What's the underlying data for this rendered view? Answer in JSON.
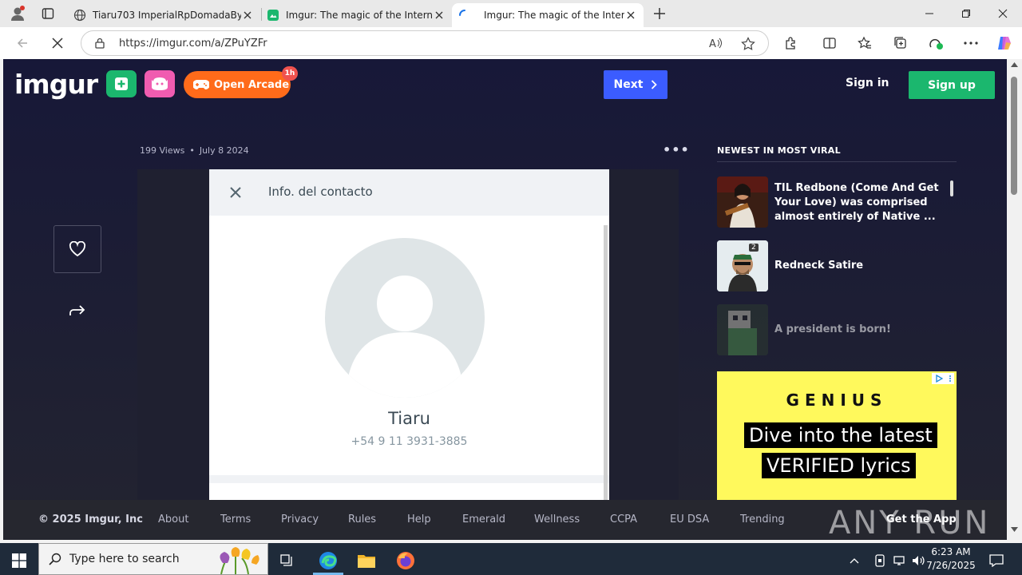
{
  "browser": {
    "tabs": [
      {
        "label": "Tiaru703 ImperialRpDomadaBy25",
        "icon": "globe-icon",
        "active": false
      },
      {
        "label": "Imgur: The magic of the Internet",
        "icon": "imgur-favicon-icon",
        "active": false
      },
      {
        "label": "Imgur: The magic of the Internet",
        "icon": "loading-spinner-icon",
        "active": true
      }
    ],
    "url": "https://imgur.com/a/ZPuYZFr"
  },
  "header": {
    "logo": "imgur",
    "arcade_label": "Open Arcade",
    "arcade_badge": "1h",
    "next_label": "Next",
    "signin_label": "Sign in",
    "signup_label": "Sign up"
  },
  "post": {
    "views": "199 Views",
    "date": "July 8 2024",
    "screenshot": {
      "title": "Info. del contacto",
      "name": "Tiaru",
      "phone": "+54 9 11 3931-3885"
    }
  },
  "sidebar": {
    "heading": "NEWEST IN MOST VIRAL",
    "items": [
      {
        "title": "TIL Redbone (Come And Get Your Love) was comprised almost entirely of Native ...",
        "count": ""
      },
      {
        "title": "Redneck Satire",
        "count": "2"
      },
      {
        "title": "A president is born!",
        "count": ""
      }
    ]
  },
  "ad": {
    "brand": "GENIUS",
    "line1": "Dive into the latest",
    "line2": "VERIFIED lyrics",
    "color": "#fff95c"
  },
  "footer": {
    "copyright": "© 2025 Imgur, Inc",
    "links": [
      "About",
      "Terms",
      "Privacy",
      "Rules",
      "Help",
      "Emerald",
      "Wellness",
      "CCPA",
      "EU DSA",
      "Trending"
    ],
    "get_app": "Get the App",
    "watermark": "ANY RUN"
  },
  "taskbar": {
    "search_placeholder": "Type here to search",
    "time": "6:23 AM",
    "date": "7/26/2025"
  },
  "colors": {
    "next": "#3b5cff",
    "signup": "#1bb76e",
    "arcade": "#ff6b1a",
    "upload": "#1bb76e",
    "meme": "#f05cb0"
  }
}
